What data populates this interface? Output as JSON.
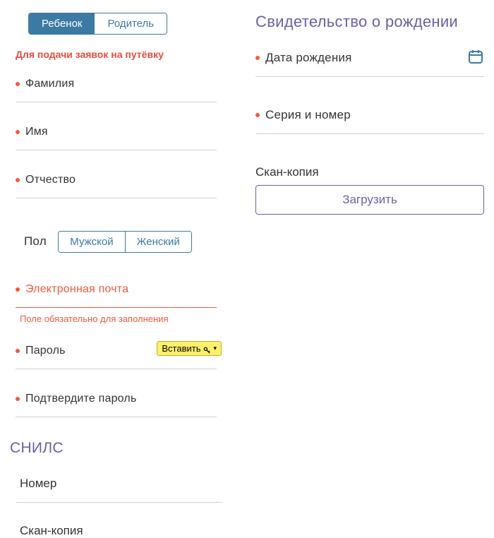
{
  "tabs": {
    "child": "Ребенок",
    "parent": "Родитель"
  },
  "notice": "Для подачи заявок на путёвку",
  "left": {
    "lastname": "Фамилия",
    "firstname": "Имя",
    "patronymic": "Отчество",
    "gender_label": "Пол",
    "gender_male": "Мужской",
    "gender_female": "Женский",
    "email": "Электронная почта",
    "email_error": "Поле обязательно для заполнения",
    "password": "Пароль",
    "insert_label": "Вставить",
    "confirm_password": "Подтвердите пароль"
  },
  "snils": {
    "title": "СНИЛС",
    "number": "Номер",
    "scan": "Скан-копия"
  },
  "right": {
    "title": "Свидетельство о рождении",
    "birthdate": "Дата рождения",
    "series_number": "Серия и номер",
    "scan_label": "Скан-копия",
    "upload": "Загрузить"
  }
}
